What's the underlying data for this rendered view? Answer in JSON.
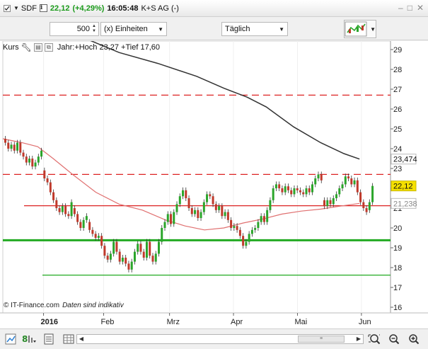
{
  "titlebar": {
    "symbol": "SDF",
    "info": "i",
    "price": "22,12",
    "change": "(+4,29%)",
    "time": "16:05:48",
    "company": "K+S AG (-)",
    "minimize": "–",
    "restore": "□",
    "close": "✕"
  },
  "controls": {
    "quantity": "500",
    "unit": "(x) Einheiten",
    "period": "Täglich"
  },
  "chart_header": {
    "label": "Kurs",
    "info": "Jahr:+Hoch 23,27 +Tief 17,60"
  },
  "watermark": {
    "source": "© IT-Finance.com",
    "note": "Daten sind indikativ"
  },
  "chart_data": {
    "type": "line",
    "y_axis": {
      "min": 16,
      "max": 29,
      "position": "right",
      "ticks": [
        "29",
        "28",
        "27",
        "26",
        "25",
        "24",
        "23",
        "22",
        "21",
        "20",
        "19",
        "18",
        "17",
        "16"
      ]
    },
    "x_ticks": [
      {
        "label": "2016",
        "bold": true
      },
      {
        "label": "Feb",
        "bold": false
      },
      {
        "label": "Mrz",
        "bold": false
      },
      {
        "label": "Apr",
        "bold": false
      },
      {
        "label": "Mai",
        "bold": false
      },
      {
        "label": "Jun",
        "bold": false
      }
    ],
    "value_labels": [
      {
        "text": "23,474",
        "value": 23.474,
        "style": "box"
      },
      {
        "text": "22,12",
        "value": 22.12,
        "style": "yellow"
      },
      {
        "text": "21,238",
        "value": 21.238,
        "style": "box-light"
      }
    ],
    "horizontal_lines": [
      {
        "value": 26.7,
        "color": "#dd2222",
        "style": "dashed"
      },
      {
        "value": 22.7,
        "color": "#dd2222",
        "style": "dashed"
      },
      {
        "value": 21.12,
        "color": "#dd2222",
        "style": "solid"
      },
      {
        "value": 19.38,
        "color": "#22aa22",
        "style": "solid-thick"
      },
      {
        "value": 17.62,
        "color": "#22aa22",
        "style": "solid"
      }
    ],
    "series": [
      {
        "kind": "ma-long",
        "color": "#333333",
        "points": [
          [
            0.22,
            29.5
          ],
          [
            0.3,
            28.85
          ],
          [
            0.4,
            28.3
          ],
          [
            0.5,
            27.65
          ],
          [
            0.57,
            27.05
          ],
          [
            0.63,
            26.6
          ],
          [
            0.68,
            26.1
          ],
          [
            0.75,
            25.1
          ],
          [
            0.82,
            24.3
          ],
          [
            0.88,
            23.75
          ],
          [
            0.92,
            23.474
          ]
        ]
      },
      {
        "kind": "ma-short",
        "color": "#e07070",
        "points": [
          [
            0.0,
            24.5
          ],
          [
            0.05,
            24.3
          ],
          [
            0.09,
            24.1
          ],
          [
            0.13,
            23.5
          ],
          [
            0.18,
            22.7
          ],
          [
            0.24,
            21.8
          ],
          [
            0.3,
            21.2
          ],
          [
            0.36,
            20.9
          ],
          [
            0.42,
            20.4
          ],
          [
            0.47,
            20.1
          ],
          [
            0.52,
            19.9
          ],
          [
            0.57,
            20.0
          ],
          [
            0.62,
            20.25
          ],
          [
            0.67,
            20.45
          ],
          [
            0.72,
            20.7
          ],
          [
            0.77,
            20.85
          ],
          [
            0.82,
            20.95
          ],
          [
            0.87,
            21.1
          ],
          [
            0.92,
            21.238
          ]
        ]
      }
    ],
    "candles": [
      [
        24.5,
        24.3
      ],
      [
        24.3,
        24.0
      ],
      [
        24.0,
        24.2
      ],
      [
        24.2,
        23.9
      ],
      [
        23.9,
        24.3
      ],
      [
        24.3,
        23.8
      ],
      [
        23.8,
        23.6
      ],
      [
        23.6,
        23.3
      ],
      [
        23.3,
        23.5
      ],
      [
        23.5,
        23.1
      ],
      [
        23.1,
        23.3
      ],
      [
        23.3,
        23.6
      ],
      [
        23.6,
        23.9
      ],
      [
        22.9,
        22.5
      ],
      [
        22.5,
        22.3
      ],
      [
        22.3,
        21.8
      ],
      [
        21.8,
        21.4
      ],
      [
        21.4,
        21.0
      ],
      [
        21.0,
        20.8
      ],
      [
        20.8,
        21.1
      ],
      [
        21.1,
        20.7
      ],
      [
        20.7,
        20.6
      ],
      [
        20.6,
        21.3
      ],
      [
        21.0,
        20.7
      ],
      [
        20.7,
        20.3
      ],
      [
        20.3,
        20.0
      ],
      [
        20.0,
        20.4
      ],
      [
        20.4,
        20.6
      ],
      [
        20.3,
        19.9
      ],
      [
        19.9,
        19.7
      ],
      [
        19.7,
        19.5
      ],
      [
        19.5,
        19.6
      ],
      [
        19.6,
        19.1
      ],
      [
        19.1,
        18.6
      ],
      [
        18.6,
        18.4
      ],
      [
        18.4,
        18.7
      ],
      [
        18.7,
        19.3
      ],
      [
        19.3,
        18.8
      ],
      [
        18.8,
        18.3
      ],
      [
        18.3,
        18.5
      ],
      [
        18.5,
        18.2
      ],
      [
        18.2,
        17.9
      ],
      [
        17.9,
        18.3
      ],
      [
        18.3,
        18.8
      ],
      [
        18.8,
        19.2
      ],
      [
        19.2,
        18.8
      ],
      [
        18.8,
        18.5
      ],
      [
        18.5,
        19.3
      ],
      [
        19.3,
        18.6
      ],
      [
        18.6,
        18.3
      ],
      [
        18.3,
        18.7
      ],
      [
        18.7,
        19.3
      ],
      [
        19.3,
        20.0
      ],
      [
        20.0,
        20.3
      ],
      [
        20.3,
        20.7
      ],
      [
        20.7,
        20.2
      ],
      [
        20.2,
        20.8
      ],
      [
        20.8,
        21.2
      ],
      [
        21.2,
        21.6
      ],
      [
        21.6,
        21.9
      ],
      [
        21.9,
        21.5
      ],
      [
        21.5,
        21.0
      ],
      [
        21.0,
        20.7
      ],
      [
        20.7,
        20.9
      ],
      [
        20.9,
        20.5
      ],
      [
        20.5,
        20.8
      ],
      [
        20.8,
        21.3
      ],
      [
        21.3,
        21.7
      ],
      [
        21.7,
        21.6
      ],
      [
        21.6,
        21.2
      ],
      [
        21.2,
        20.9
      ],
      [
        20.9,
        21.1
      ],
      [
        21.1,
        20.6
      ],
      [
        20.6,
        20.8
      ],
      [
        20.8,
        20.4
      ],
      [
        20.4,
        20.0
      ],
      [
        20.0,
        20.1
      ],
      [
        20.1,
        19.9
      ],
      [
        19.9,
        19.6
      ],
      [
        19.6,
        19.1
      ],
      [
        19.1,
        19.3
      ],
      [
        19.3,
        19.7
      ],
      [
        19.7,
        19.9
      ],
      [
        19.9,
        20.0
      ],
      [
        20.0,
        20.3
      ],
      [
        20.3,
        20.6
      ],
      [
        20.6,
        20.3
      ],
      [
        20.3,
        20.9
      ],
      [
        20.9,
        21.4
      ],
      [
        21.4,
        22.0
      ],
      [
        22.0,
        22.2
      ],
      [
        22.2,
        22.0
      ],
      [
        22.0,
        21.8
      ],
      [
        21.8,
        22.1
      ],
      [
        22.1,
        21.9
      ],
      [
        21.9,
        21.7
      ],
      [
        21.7,
        22.0
      ],
      [
        22.0,
        21.9
      ],
      [
        21.9,
        21.8
      ],
      [
        21.8,
        21.7
      ],
      [
        21.7,
        22.0
      ],
      [
        22.0,
        21.8
      ],
      [
        21.8,
        22.2
      ],
      [
        22.2,
        22.5
      ],
      [
        22.5,
        22.7
      ],
      [
        22.7,
        22.4
      ],
      [
        21.4,
        21.1
      ],
      [
        21.1,
        21.4
      ],
      [
        21.4,
        21.2
      ],
      [
        21.2,
        21.5
      ],
      [
        21.5,
        21.7
      ],
      [
        21.7,
        22.0
      ],
      [
        22.0,
        22.2
      ],
      [
        22.2,
        22.6
      ],
      [
        22.6,
        22.5
      ],
      [
        22.5,
        22.2
      ],
      [
        22.2,
        22.4
      ],
      [
        22.4,
        21.8
      ],
      [
        21.8,
        21.3
      ],
      [
        21.3,
        21.0
      ],
      [
        21.0,
        20.8
      ],
      [
        20.9,
        21.3
      ],
      [
        21.3,
        22.12
      ]
    ],
    "candle_colors": {
      "up": "#2aa52a",
      "down": "#c0392b"
    }
  }
}
